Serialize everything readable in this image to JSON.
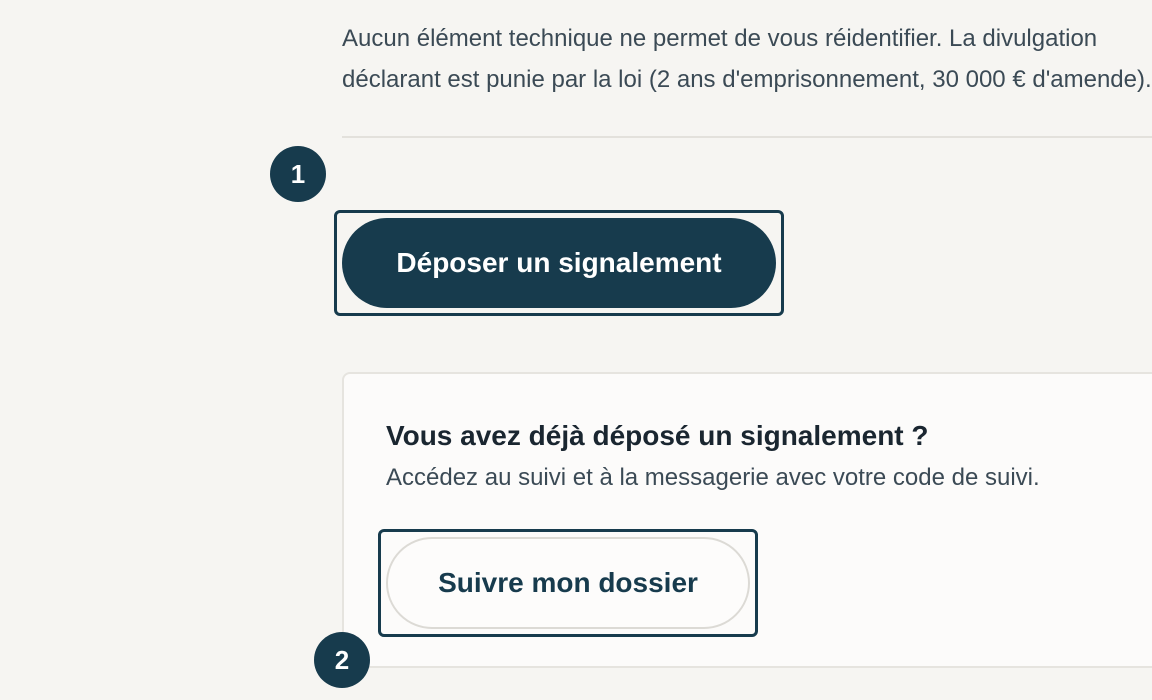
{
  "intro": {
    "line1": "Aucun élément technique ne permet de vous réidentifier. La divulgation",
    "line2": "déclarant est punie par la loi (2 ans d'emprisonnement, 30 000 € d'amende)."
  },
  "steps": {
    "marker1": "1",
    "marker2": "2"
  },
  "primary": {
    "label": "Déposer un signalement"
  },
  "follow": {
    "heading": "Vous avez déjà déposé un signalement ?",
    "text": "Accédez au suivi et à la messagerie avec votre code de suivi.",
    "button_label": "Suivre mon dossier"
  },
  "colors": {
    "background": "#f6f5f2",
    "primary": "#173b4d",
    "card_background": "#fcfbfa"
  }
}
